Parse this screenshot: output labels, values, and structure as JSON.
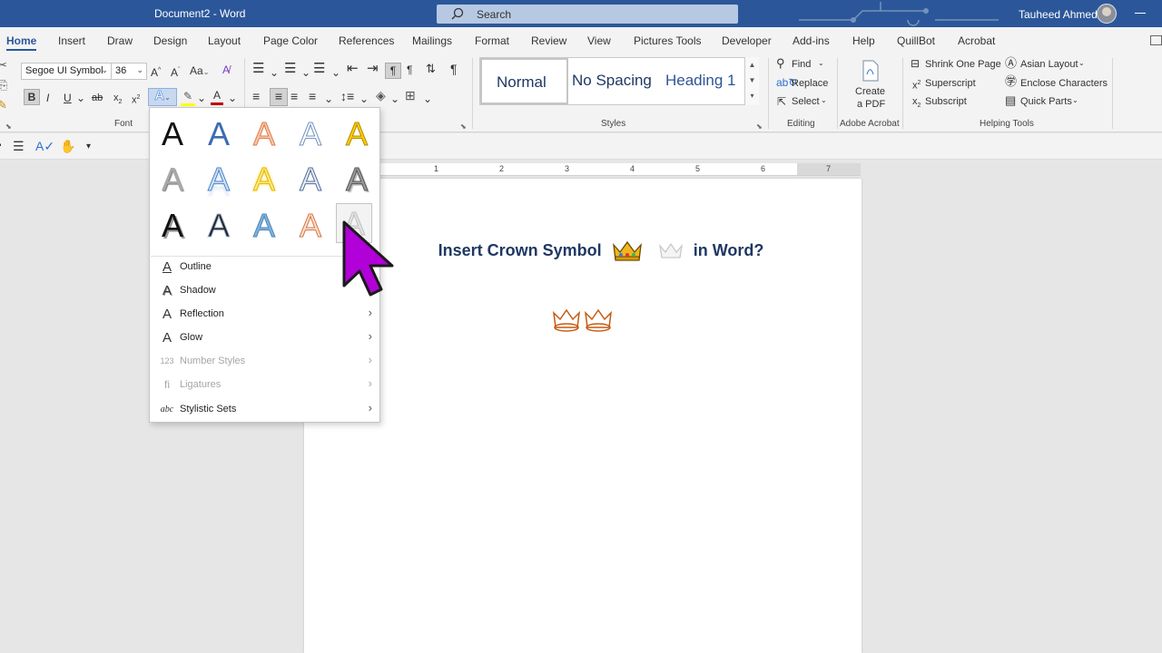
{
  "window": {
    "title": "Document2  -  Word",
    "user": "Tauheed Ahmed"
  },
  "search": {
    "placeholder": "Search"
  },
  "tabs": [
    "Home",
    "Insert",
    "Draw",
    "Design",
    "Layout",
    "Page Color",
    "References",
    "Mailings",
    "Format",
    "Review",
    "View",
    "Pictures Tools",
    "Developer",
    "Add-ins",
    "Help",
    "QuillBot",
    "Acrobat"
  ],
  "font": {
    "name": "Segoe UI Symbol",
    "size": "36",
    "group_label": "Font"
  },
  "styles": {
    "items": [
      "Normal",
      "No Spacing",
      "Heading 1"
    ],
    "group_label": "Styles"
  },
  "editing": {
    "find": "Find",
    "replace": "Replace",
    "select": "Select",
    "group_label": "Editing"
  },
  "acrobat": {
    "create_line1": "Create",
    "create_line2": "a PDF",
    "group_label": "Adobe Acrobat"
  },
  "helping": {
    "shrink": "Shrink One Page",
    "superscript": "Superscript",
    "subscript": "Subscript",
    "asian": "Asian Layout",
    "enclose": "Enclose Characters",
    "quickparts": "Quick Parts",
    "group_label": "Helping Tools"
  },
  "ruler": {
    "numbers": [
      "1",
      "2",
      "3",
      "4",
      "5",
      "6",
      "7"
    ]
  },
  "document": {
    "heading_before": "Insert Crown Symbol",
    "heading_after": "in Word?"
  },
  "text_effects": {
    "gallery_letter": "A",
    "menu": [
      {
        "label": "Outline",
        "icon": "A",
        "submenu": false,
        "disabled": false
      },
      {
        "label": "Shadow",
        "icon": "A",
        "submenu": false,
        "disabled": false
      },
      {
        "label": "Reflection",
        "icon": "A",
        "submenu": true,
        "disabled": false
      },
      {
        "label": "Glow",
        "icon": "A",
        "submenu": true,
        "disabled": false
      },
      {
        "label": "Number Styles",
        "icon": "123",
        "submenu": true,
        "disabled": true
      },
      {
        "label": "Ligatures",
        "icon": "fi",
        "submenu": true,
        "disabled": true
      },
      {
        "label": "Stylistic Sets",
        "icon": "abc",
        "submenu": true,
        "disabled": false
      }
    ]
  },
  "colors": {
    "titlebar": "#2b579a",
    "heading": "#1f3864",
    "crown_outline": "#c55a11",
    "cursor": "#b100d8"
  }
}
